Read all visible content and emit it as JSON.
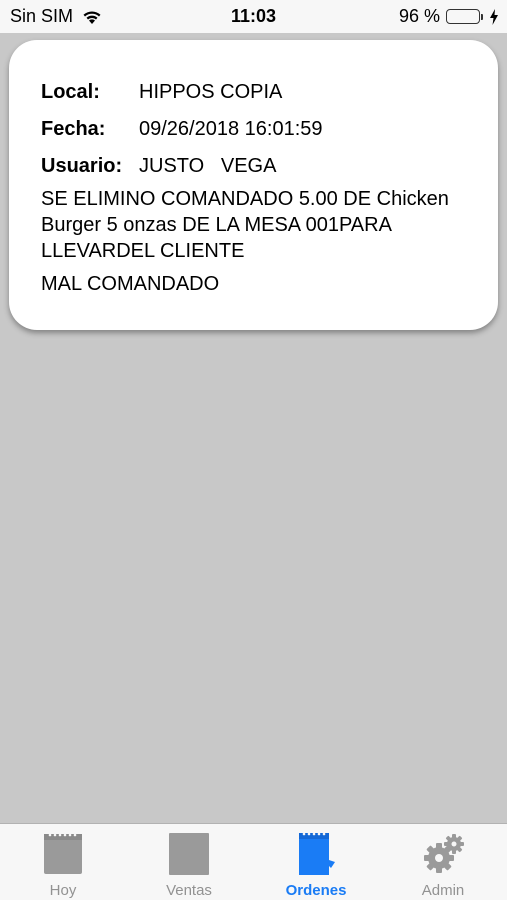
{
  "status_bar": {
    "carrier": "Sin SIM",
    "time": "11:03",
    "battery_percent": "96 %",
    "battery_level": 0.96,
    "battery_color": "#4cd964"
  },
  "record": {
    "local_label": "Local:",
    "local_value": "HIPPOS COPIA",
    "fecha_label": "Fecha:",
    "fecha_value": "09/26/2018 16:01:59",
    "usuario_label": "Usuario:",
    "usuario_value": "JUSTO   VEGA",
    "message": "SE ELIMINO COMANDADO 5.00 DE Chicken Burger 5 onzas  DE LA MESA 001PARA LLEVARDEL CLIENTE",
    "reason": "MAL COMANDADO"
  },
  "tabs": [
    {
      "label": "Hoy",
      "icon": "hoy-icon",
      "active": false
    },
    {
      "label": "Ventas",
      "icon": "ventas-icon",
      "active": false
    },
    {
      "label": "Ordenes",
      "icon": "ordenes-icon",
      "active": true
    },
    {
      "label": "Admin",
      "icon": "gear-icon",
      "active": false
    }
  ],
  "colors": {
    "accent": "#1a7cf5",
    "inactive_icon": "#9a9a9a",
    "background": "#c8c8c8"
  }
}
